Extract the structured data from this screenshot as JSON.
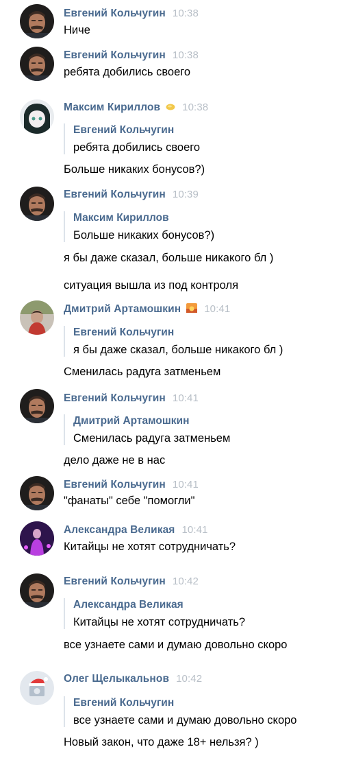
{
  "messages": [
    {
      "author": "Евгений Кольчугин",
      "time": "10:38",
      "text": "Ниче"
    },
    {
      "author": "Евгений Кольчугин",
      "time": "10:38",
      "text": "ребята добились своего"
    },
    {
      "author": "Максим Кириллов",
      "time": "10:38",
      "quote_author": "Евгений Кольчугин",
      "quote_text": "ребята добились своего",
      "text": "Больше никаких бонусов?)"
    },
    {
      "author": "Евгений Кольчугин",
      "time": "10:39",
      "quote_author": "Максим Кириллов",
      "quote_text": "Больше никаких бонусов?)",
      "text": "я бы даже сказал, больше никакого бл )",
      "text2": "ситуация вышла из под контроля"
    },
    {
      "author": "Дмитрий Артамошкин",
      "time": "10:41",
      "quote_author": "Евгений Кольчугин",
      "quote_text": "я бы даже сказал, больше никакого бл )",
      "text": "Сменилась радуга затменьем"
    },
    {
      "author": "Евгений Кольчугин",
      "time": "10:41",
      "quote_author": "Дмитрий Артамошкин",
      "quote_text": "Сменилась радуга затменьем",
      "text": "дело даже не в нас"
    },
    {
      "author": "Евгений Кольчугин",
      "time": "10:41",
      "text": "\"фанаты\" себе \"помогли\""
    },
    {
      "author": "Александра Великая",
      "time": "10:41",
      "text": "Китайцы не хотят сотрудничать?"
    },
    {
      "author": "Евгений Кольчугин",
      "time": "10:42",
      "quote_author": "Александра Великая",
      "quote_text": "Китайцы не хотят сотрудничать?",
      "text": "все узнаете сами и думаю довольно скоро"
    },
    {
      "author": "Олег Щелыкальнов",
      "time": "10:42",
      "quote_author": "Евгений Кольчугин",
      "quote_text": "все узнаете сами и думаю довольно скоро",
      "text": "Новый закон, что даже 18+ нельзя? )"
    }
  ],
  "icons": {
    "maksim_badge": "lemon-emoji-icon",
    "dmitry_badge": "sunset-emoji-icon",
    "oleg_avatar": "santa-hat-camera-icon"
  },
  "colors": {
    "author": "#4a6a8f",
    "time": "#b8bfc7",
    "quote_bar": "#dde3ea"
  }
}
